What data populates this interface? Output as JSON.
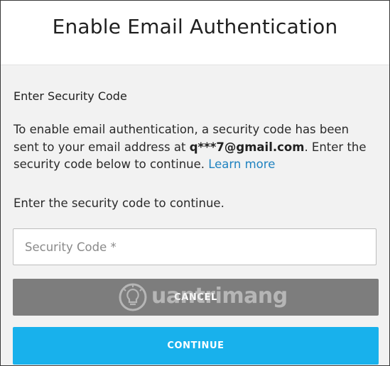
{
  "dialog": {
    "title": "Enable Email Authentication"
  },
  "content": {
    "section_title": "Enter Security Code",
    "description_part1": "To enable email authentication, a security code has been sent to your email address at ",
    "email": "q***7@gmail.com",
    "description_part2": ". Enter the security code below to continue. ",
    "learn_more": "Learn more",
    "prompt": "Enter the security code to continue."
  },
  "form": {
    "security_code_placeholder": "Security Code *",
    "security_code_value": ""
  },
  "buttons": {
    "cancel": "CANCEL",
    "continue": "CONTINUE"
  },
  "watermark": {
    "text": "uantrimang",
    "icon": "lightbulb-icon"
  },
  "colors": {
    "continue_button": "#18b1ec",
    "cancel_button": "#7d7d7d",
    "link": "#1f82c0",
    "panel_background": "#f2f2f2"
  }
}
